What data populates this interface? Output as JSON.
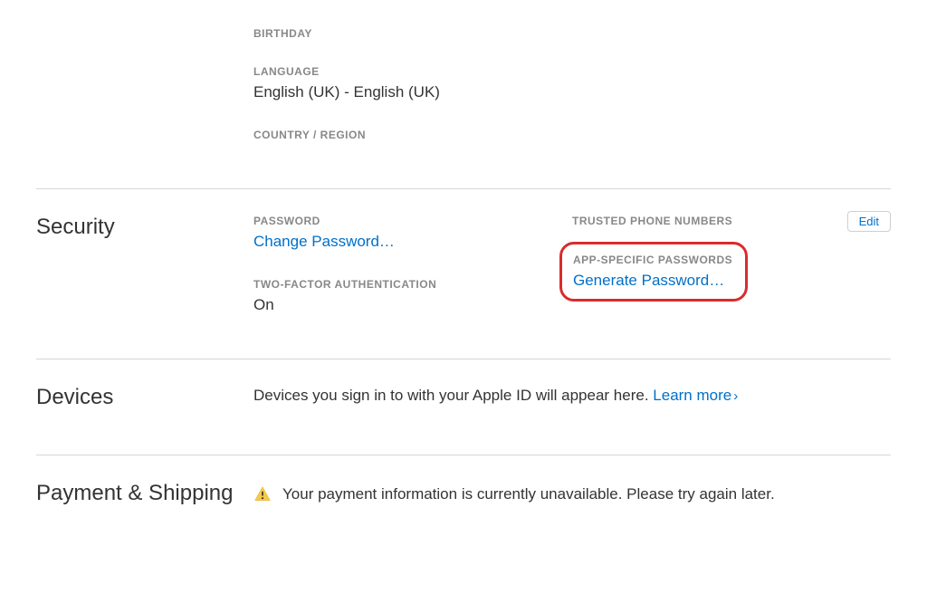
{
  "account": {
    "birthday_label": "BIRTHDAY",
    "language_label": "LANGUAGE",
    "language_value": "English (UK) - English (UK)",
    "country_label": "COUNTRY / REGION"
  },
  "security": {
    "title": "Security",
    "password_label": "PASSWORD",
    "change_password_link": "Change Password…",
    "twofactor_label": "TWO-FACTOR AUTHENTICATION",
    "twofactor_value": "On",
    "trusted_label": "TRUSTED PHONE NUMBERS",
    "appspecific_label": "APP-SPECIFIC PASSWORDS",
    "generate_link": "Generate Password…",
    "edit_button": "Edit"
  },
  "devices": {
    "title": "Devices",
    "text": "Devices you sign in to with your Apple ID will appear here. ",
    "learn_more": "Learn more"
  },
  "payment": {
    "title": "Payment & Shipping",
    "warning_text": "Your payment information is currently unavailable. Please try again later."
  }
}
